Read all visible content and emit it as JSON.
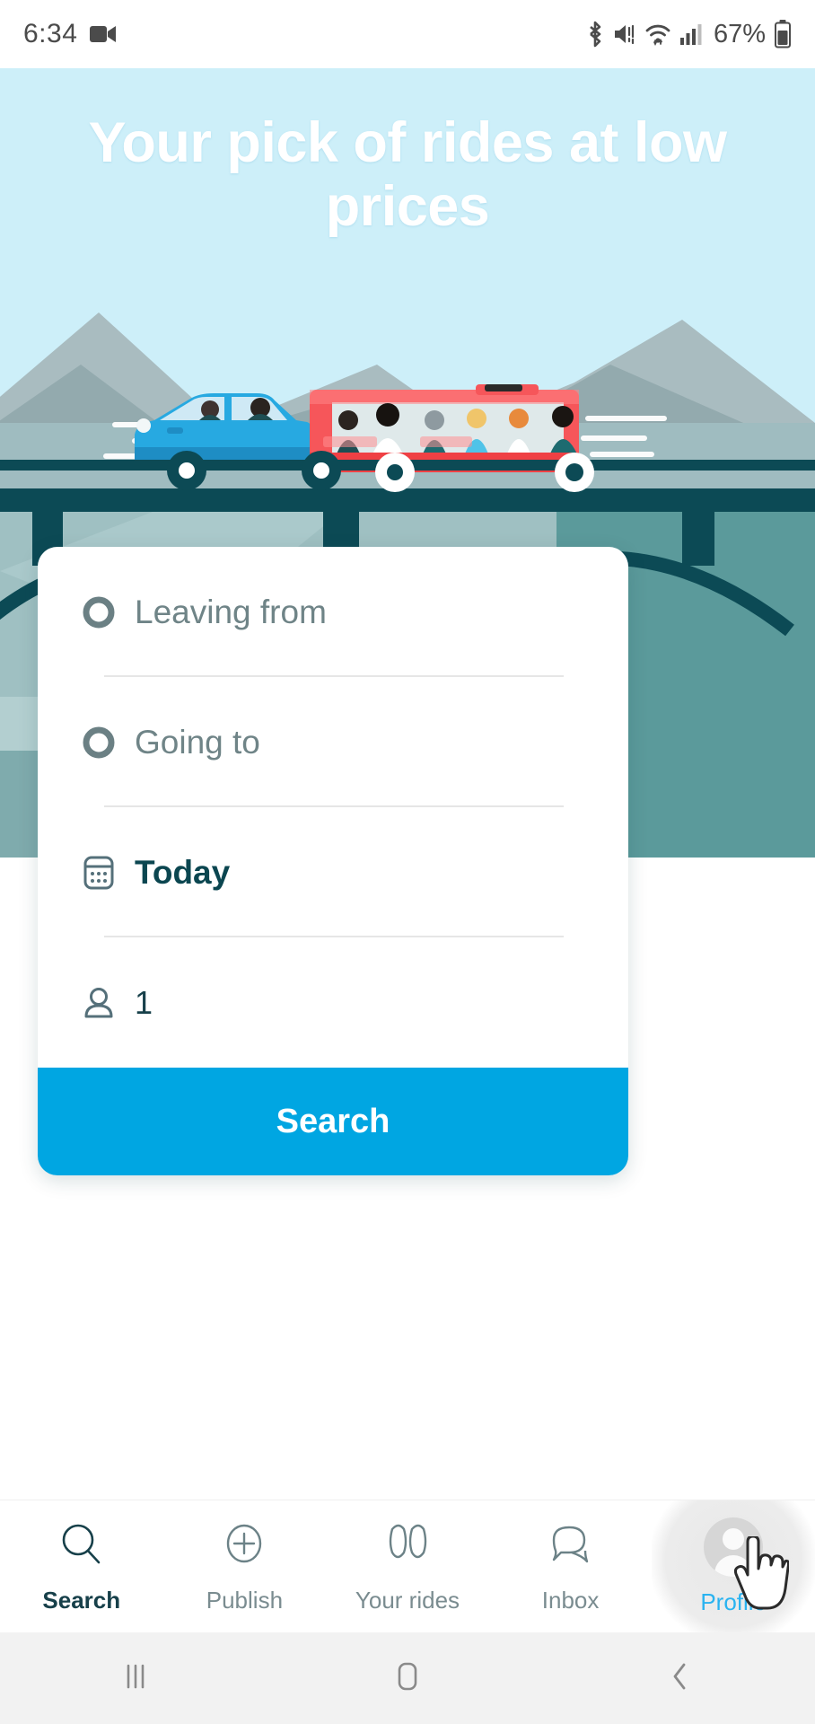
{
  "statusbar": {
    "time": "6:34",
    "battery_percent": "67%",
    "icons": [
      "video-camera-icon",
      "bluetooth-icon",
      "mute-icon",
      "wifi-icon",
      "cellular-signal-icon",
      "battery-icon"
    ]
  },
  "hero": {
    "headline": "Your pick of rides at low prices",
    "illustration": "car-and-bus-on-bridge-illustration",
    "sky_color": "#a9e2f6",
    "bridge_color": "#0c4a55",
    "car_color": "#27a9e1",
    "bus_color": "#f6565a"
  },
  "search_card": {
    "leaving_from": {
      "icon": "circle-outline-icon",
      "placeholder": "Leaving from",
      "value": ""
    },
    "going_to": {
      "icon": "circle-outline-icon",
      "placeholder": "Going to",
      "value": ""
    },
    "date": {
      "icon": "calendar-icon",
      "value": "Today"
    },
    "passengers": {
      "icon": "person-icon",
      "value": "1"
    },
    "search_button": {
      "label": "Search",
      "color": "#00A6E2"
    }
  },
  "bottom_nav": {
    "items": [
      {
        "label": "Search",
        "icon": "magnifier-icon",
        "state": "active"
      },
      {
        "label": "Publish",
        "icon": "plus-circle-icon",
        "state": "default"
      },
      {
        "label": "Your rides",
        "icon": "rides-icon",
        "state": "default"
      },
      {
        "label": "Inbox",
        "icon": "chat-bubble-icon",
        "state": "default"
      },
      {
        "label": "Profile",
        "icon": "avatar-icon",
        "state": "pressed"
      }
    ],
    "active_color": "#17404a",
    "pressed_color": "#2ab3f0"
  },
  "system_nav": {
    "recents": "recents-icon",
    "home": "home-icon",
    "back": "back-icon"
  }
}
